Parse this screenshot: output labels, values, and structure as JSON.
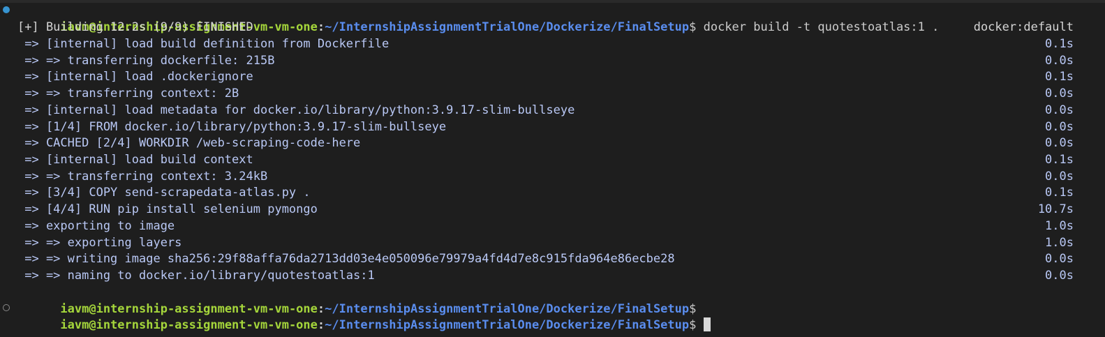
{
  "prompt": {
    "user_host": "iavm@internship-assignment-vm-vm-one",
    "colon": ":",
    "path": "~/InternshipAssignmentTrialOne/Dockerize/FinalSetup",
    "dollar": "$"
  },
  "command": " docker build -t quotestoatlas:1 .",
  "build": {
    "header": "[+] Building 12.2s (9/9) FINISHED",
    "context_label": "docker:default",
    "steps": [
      {
        "text": " => [internal] load build definition from Dockerfile",
        "time": "0.1s"
      },
      {
        "text": " => => transferring dockerfile: 215B",
        "time": "0.0s"
      },
      {
        "text": " => [internal] load .dockerignore",
        "time": "0.1s"
      },
      {
        "text": " => => transferring context: 2B",
        "time": "0.0s"
      },
      {
        "text": " => [internal] load metadata for docker.io/library/python:3.9.17-slim-bullseye",
        "time": "0.0s"
      },
      {
        "text": " => [1/4] FROM docker.io/library/python:3.9.17-slim-bullseye",
        "time": "0.0s"
      },
      {
        "text": " => CACHED [2/4] WORKDIR /web-scraping-code-here",
        "time": "0.0s"
      },
      {
        "text": " => [internal] load build context",
        "time": "0.1s"
      },
      {
        "text": " => => transferring context: 3.24kB",
        "time": "0.0s"
      },
      {
        "text": " => [3/4] COPY send-scrapedata-atlas.py .",
        "time": "0.1s"
      },
      {
        "text": " => [4/4] RUN pip install selenium pymongo",
        "time": "10.7s"
      },
      {
        "text": " => exporting to image",
        "time": "1.0s"
      },
      {
        "text": " => => exporting layers",
        "time": "1.0s"
      },
      {
        "text": " => => writing image sha256:29f88affa76da2713dd03e4e050096e79979a4fd4d7e8c915fda964e86ecbe28",
        "time": "0.0s"
      },
      {
        "text": " => => naming to docker.io/library/quotestoatlas:1",
        "time": "0.0s"
      }
    ]
  },
  "icons": {
    "gutter_success": "filled-circle-decoration",
    "gutter_pending": "hollow-circle-decoration",
    "cursor": "block-cursor"
  },
  "colors": {
    "background": "#1e1e1e",
    "prompt_user": "#a5d63b",
    "prompt_path": "#5a8dee",
    "output_text": "#b9c8f5",
    "decoration_success": "#3794d1"
  }
}
